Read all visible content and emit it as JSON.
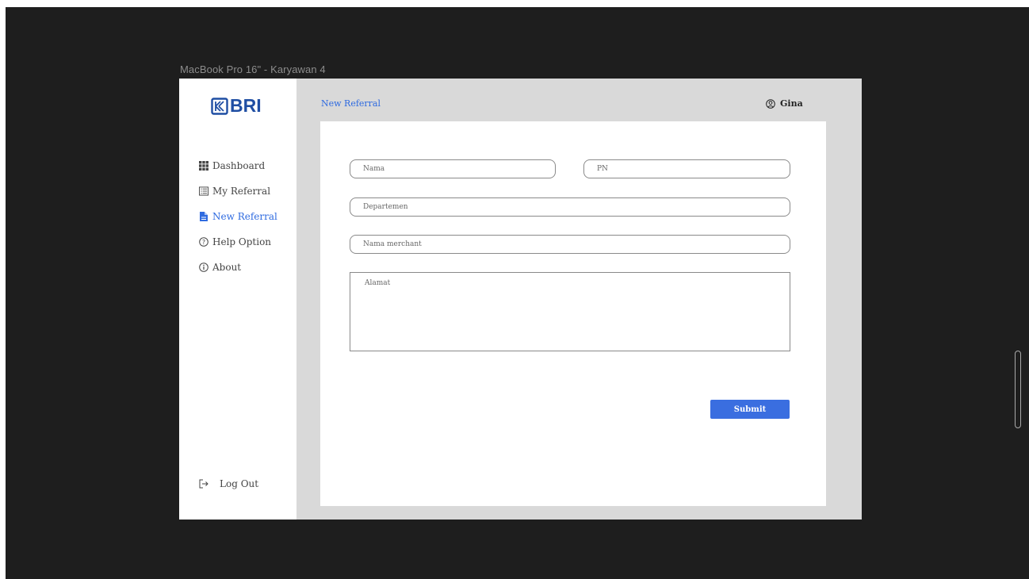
{
  "frame_title": "MacBook Pro 16\" - Karyawan 4",
  "brand": {
    "name": "BRI",
    "color": "#1f4ea3"
  },
  "accent_color": "#2f6be0",
  "sidebar": {
    "items": [
      {
        "label": "Dashboard",
        "icon": "grid-icon",
        "active": false
      },
      {
        "label": "My Referral",
        "icon": "list-icon",
        "active": false
      },
      {
        "label": "New Referral",
        "icon": "document-icon",
        "active": true
      },
      {
        "label": "Help Option",
        "icon": "help-icon",
        "active": false
      },
      {
        "label": "About",
        "icon": "info-icon",
        "active": false
      }
    ],
    "logout_label": "Log Out"
  },
  "header": {
    "title": "New Referral",
    "user_name": "Gina"
  },
  "form": {
    "nama_placeholder": "Nama",
    "pn_placeholder": "PN",
    "departemen_placeholder": "Departemen",
    "merchant_placeholder": "Nama merchant",
    "alamat_placeholder": "Alamat",
    "submit_label": "Submit"
  }
}
